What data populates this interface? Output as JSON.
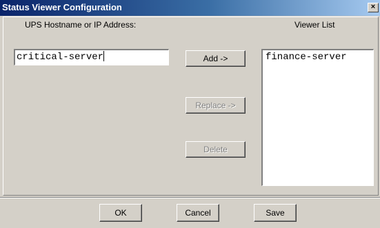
{
  "window": {
    "title": "Status Viewer Configuration",
    "close_glyph": "×"
  },
  "form": {
    "host_label": "UPS Hostname or IP Address:",
    "host_value": "critical-server",
    "viewer_list_label": "Viewer List",
    "viewer_list": [
      "finance-server"
    ]
  },
  "buttons": {
    "add": "Add ->",
    "replace": "Replace ->",
    "delete": "Delete",
    "ok": "OK",
    "cancel": "Cancel",
    "save": "Save"
  },
  "icons": {
    "close": "close-icon"
  }
}
